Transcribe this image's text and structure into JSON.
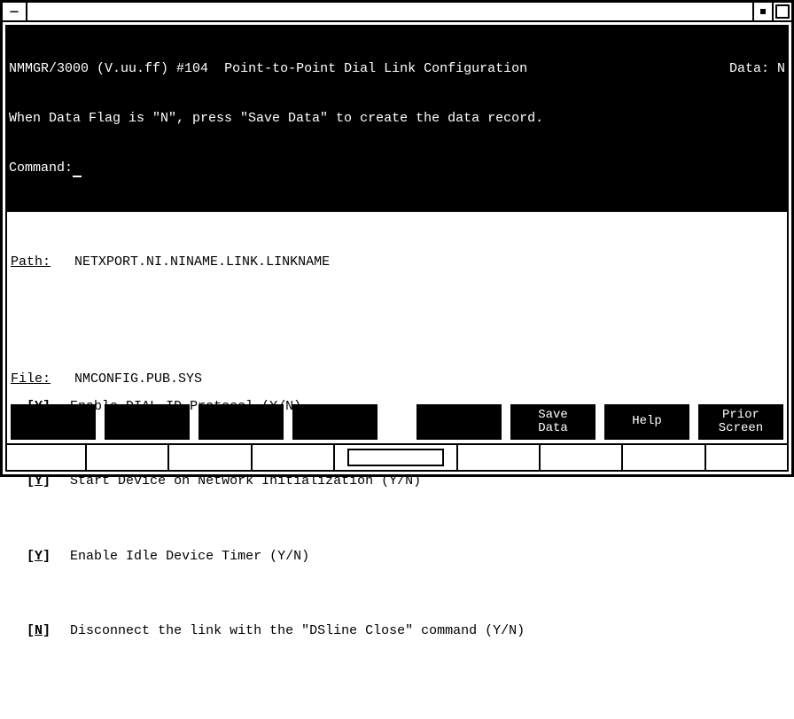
{
  "titlebar": {
    "menu_glyph": "—"
  },
  "header": {
    "program": "NMMGR/3000 (V.uu.ff) #104",
    "title": "Point-to-Point Dial Link Configuration",
    "data_label": "Data:",
    "data_value": "N",
    "hint": "When Data Flag is \"N\", press \"Save Data\" to create the data record.",
    "command_label": "Command:"
  },
  "path": {
    "label": "Path:",
    "value": "NETXPORT.NI.NINAME.LINK.LINKNAME"
  },
  "fields": [
    {
      "value": "Y",
      "label": "Enable DIAL ID Protocol (Y/N)"
    },
    {
      "value": "Y",
      "label": "Start Device on Network Initialization (Y/N)"
    },
    {
      "value": "Y",
      "label": "Enable Idle Device Timer (Y/N)"
    },
    {
      "value": "N",
      "label": "Disconnect the link with the \"DSline Close\" command (Y/N)"
    }
  ],
  "file": {
    "label": "File:",
    "value": "NMCONFIG.PUB.SYS"
  },
  "fkeys": {
    "f1": "",
    "f2": "",
    "f3": "",
    "f4": "",
    "f5": "",
    "f6": "Save\nData",
    "f7": "Help",
    "f8": "Prior\nScreen"
  }
}
